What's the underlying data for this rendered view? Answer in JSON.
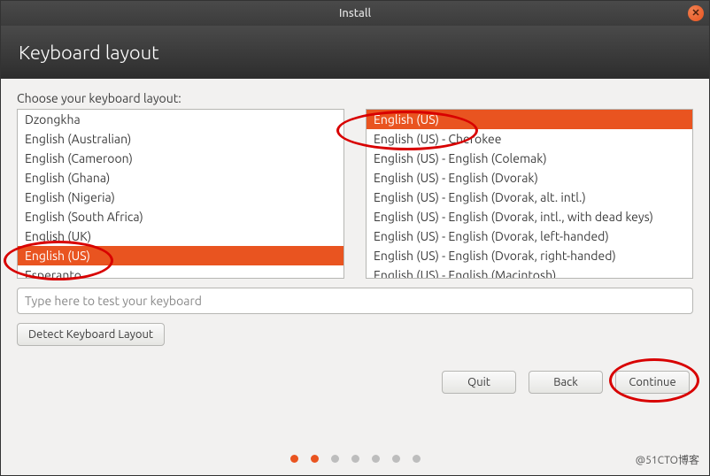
{
  "window": {
    "title": "Install"
  },
  "header": {
    "heading": "Keyboard layout"
  },
  "prompt": "Choose your keyboard layout:",
  "left_list": {
    "items": [
      "Dzongkha",
      "English (Australian)",
      "English (Cameroon)",
      "English (Ghana)",
      "English (Nigeria)",
      "English (South Africa)",
      "English (UK)",
      "English (US)",
      "Esperanto"
    ],
    "selected_index": 7
  },
  "right_list": {
    "items": [
      "English (US)",
      "English (US) - Cherokee",
      "English (US) - English (Colemak)",
      "English (US) - English (Dvorak)",
      "English (US) - English (Dvorak, alt. intl.)",
      "English (US) - English (Dvorak, intl., with dead keys)",
      "English (US) - English (Dvorak, left-handed)",
      "English (US) - English (Dvorak, right-handed)",
      "English (US) - English (Macintosh)"
    ],
    "selected_index": 0
  },
  "test_input": {
    "placeholder": "Type here to test your keyboard",
    "value": ""
  },
  "buttons": {
    "detect": "Detect Keyboard Layout",
    "quit": "Quit",
    "back": "Back",
    "continue": "Continue"
  },
  "pager": {
    "total": 7,
    "active": [
      0,
      1
    ]
  },
  "watermark": "@51CTO博客",
  "close_glyph": "✕"
}
